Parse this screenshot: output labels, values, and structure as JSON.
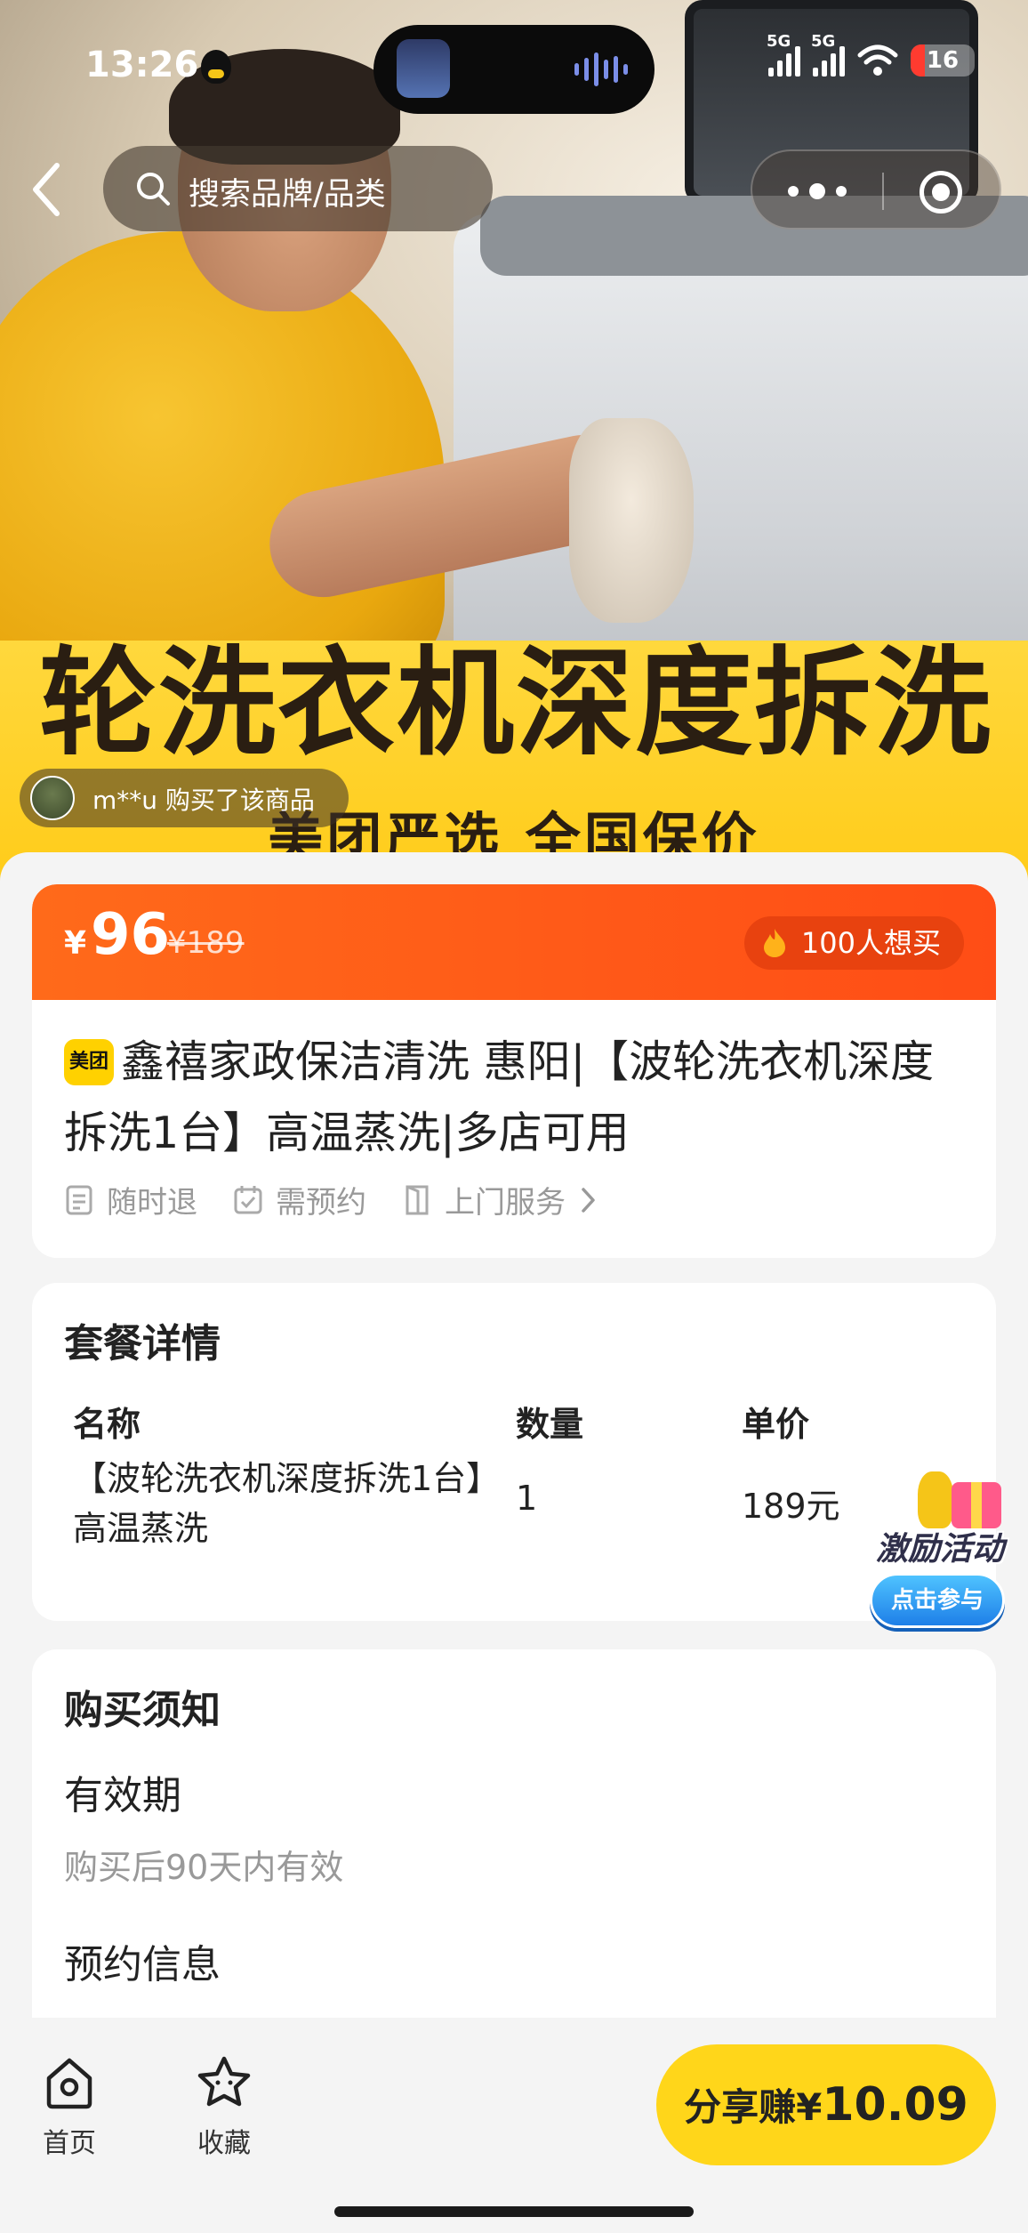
{
  "status_bar": {
    "time": "13:26",
    "network_1": "5G",
    "network_2": "5G",
    "battery": "16"
  },
  "nav": {
    "search_placeholder": "搜索品牌/品类"
  },
  "hero": {
    "banner_text": "轮洗衣机深度拆洗",
    "banner_sub": "美团严选 全国保价",
    "recent_buyer": "m**u 购买了该商品"
  },
  "price": {
    "currency": "¥",
    "current": "96",
    "original": "¥189",
    "want_count": "100人想买"
  },
  "product": {
    "brand_badge": "美团",
    "title": "鑫禧家政保洁清洗 惠阳|【波轮洗衣机深度拆洗1台】高温蒸洗|多店可用",
    "tags": [
      "随时退",
      "需预约",
      "上门服务"
    ]
  },
  "package": {
    "section_title": "套餐详情",
    "headers": [
      "名称",
      "数量",
      "单价"
    ],
    "rows": [
      {
        "name": "【波轮洗衣机深度拆洗1台】高温蒸洗",
        "qty": "1",
        "price": "189元"
      }
    ]
  },
  "activity": {
    "title": "激励活动",
    "button": "点击参与"
  },
  "notice": {
    "section_title": "购买须知",
    "validity_title": "有效期",
    "validity_body": "购买后90天内有效",
    "booking_title": "预约信息"
  },
  "bottom_bar": {
    "home_label": "首页",
    "favorite_label": "收藏",
    "share_label": "分享赚",
    "share_currency": "¥",
    "share_amount": "10.09"
  },
  "colors": {
    "accent_orange": "#ff5a16",
    "brand_yellow": "#ffd61a"
  }
}
